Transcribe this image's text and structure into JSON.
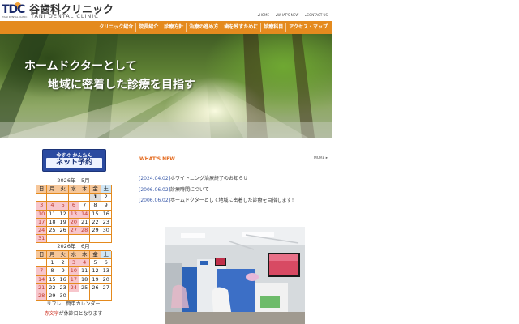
{
  "header": {
    "logo_mark": "TDC",
    "logo_sub": "TANI DENTAL CLINIC",
    "clinic_name": "谷歯科クリニック",
    "clinic_name_en": "TANI DENTAL CLINIC",
    "top_links": [
      "▸HOME",
      "▸WHAT'S NEW",
      "▸CONTACT US"
    ]
  },
  "nav": {
    "items": [
      "クリニック紹介",
      "院長紹介",
      "診療方針",
      "治療の進め方",
      "歯を残すために",
      "診療科目",
      "アクセス・マップ"
    ]
  },
  "hero": {
    "line1": "ホームドクターとして",
    "line2": "地域に密着した診療を目指す"
  },
  "reserve": {
    "top": "今すぐ かんたん",
    "main": "ネット予約"
  },
  "calendar": {
    "months": [
      {
        "title": "2026年　5月",
        "weekdays": [
          "日",
          "月",
          "火",
          "水",
          "木",
          "金",
          "土"
        ],
        "rows": [
          [
            "",
            "",
            "",
            "",
            "",
            "1",
            "2"
          ],
          [
            "3",
            "4",
            "5",
            "6",
            "7",
            "8",
            "9"
          ],
          [
            "10",
            "11",
            "12",
            "13",
            "14",
            "15",
            "16"
          ],
          [
            "17",
            "18",
            "19",
            "20",
            "21",
            "22",
            "23"
          ],
          [
            "24",
            "25",
            "26",
            "27",
            "28",
            "29",
            "30"
          ],
          [
            "31",
            "",
            "",
            "",
            "",
            "",
            ""
          ]
        ]
      },
      {
        "title": "2026年　6月",
        "weekdays": [
          "日",
          "月",
          "火",
          "水",
          "木",
          "金",
          "土"
        ],
        "rows": [
          [
            "",
            "1",
            "2",
            "3",
            "4",
            "5",
            "6"
          ],
          [
            "7",
            "8",
            "9",
            "10",
            "11",
            "12",
            "13"
          ],
          [
            "14",
            "15",
            "16",
            "17",
            "18",
            "19",
            "20"
          ],
          [
            "21",
            "22",
            "23",
            "24",
            "25",
            "26",
            "27"
          ],
          [
            "28",
            "29",
            "30",
            "",
            "",
            "",
            ""
          ]
        ]
      }
    ],
    "caption": "リフレ　簡単カレンダー",
    "note_red": "赤文字",
    "note_rest": "が休診日となります"
  },
  "news": {
    "title": "WHAT'S NEW",
    "more": "MORE ▸",
    "items": [
      {
        "date": "[2024.04.02]",
        "text": "ホワイトニング治療終了のお知らせ"
      },
      {
        "date": "[2006.06.02]",
        "text": "診療時間について"
      },
      {
        "date": "[2006.06.02]",
        "text": "ホームドクターとして地域に密着した診療を目指します！"
      }
    ]
  },
  "colors": {
    "accent_orange": "#e48a1e",
    "link_blue": "#3858a8",
    "holiday_pink": "#f7c6cc"
  }
}
